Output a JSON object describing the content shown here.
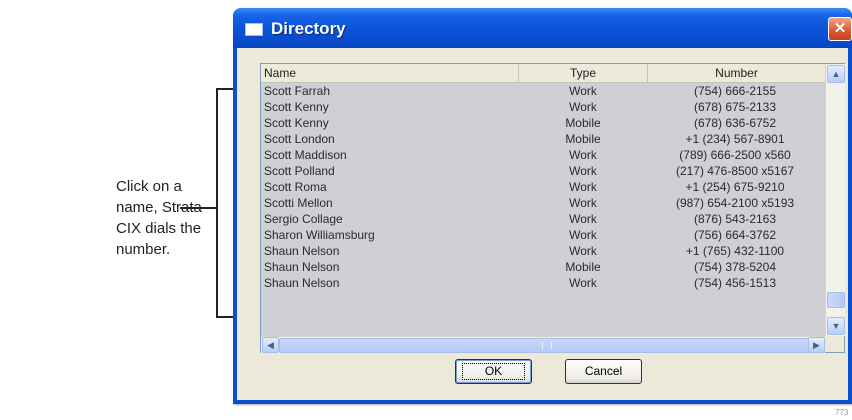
{
  "callout": {
    "text": "Click on a name, Strata CIX dials the number."
  },
  "window": {
    "title": "Directory",
    "close_glyph": "✕"
  },
  "columns": {
    "name": "Name",
    "type": "Type",
    "number": "Number"
  },
  "rows": [
    {
      "name": "Scott Farrah",
      "type": "Work",
      "number": "(754) 666-2155"
    },
    {
      "name": "Scott Kenny",
      "type": "Work",
      "number": "(678) 675-2133"
    },
    {
      "name": "Scott Kenny",
      "type": "Mobile",
      "number": "(678) 636-6752"
    },
    {
      "name": "Scott London",
      "type": "Mobile",
      "number": "+1 (234) 567-8901"
    },
    {
      "name": "Scott Maddison",
      "type": "Work",
      "number": "(789) 666-2500 x560"
    },
    {
      "name": "Scott Polland",
      "type": "Work",
      "number": "(217) 476-8500 x5167"
    },
    {
      "name": "Scott Roma",
      "type": "Work",
      "number": "+1 (254) 675-9210"
    },
    {
      "name": "Scotti Mellon",
      "type": "Work",
      "number": "(987) 654-2100 x5193"
    },
    {
      "name": "Sergio Collage",
      "type": "Work",
      "number": "(876) 543-2163"
    },
    {
      "name": "Sharon Williamsburg",
      "type": "Work",
      "number": "(756) 664-3762"
    },
    {
      "name": "Shaun Nelson",
      "type": "Work",
      "number": "+1 (765) 432-1100"
    },
    {
      "name": "Shaun Nelson",
      "type": "Mobile",
      "number": "(754) 378-5204"
    },
    {
      "name": "Shaun Nelson",
      "type": "Work",
      "number": "(754) 456-1513"
    }
  ],
  "buttons": {
    "ok": "OK",
    "cancel": "Cancel"
  },
  "scroll": {
    "up_glyph": "▲",
    "down_glyph": "▼",
    "left_glyph": "◀",
    "right_glyph": "▶"
  },
  "watermark": "773",
  "colors": {
    "titlebar": "#0a52d8",
    "close_button": "#dd5530",
    "list_background": "#cfd0d3",
    "dialog_face": "#ece9d8"
  }
}
